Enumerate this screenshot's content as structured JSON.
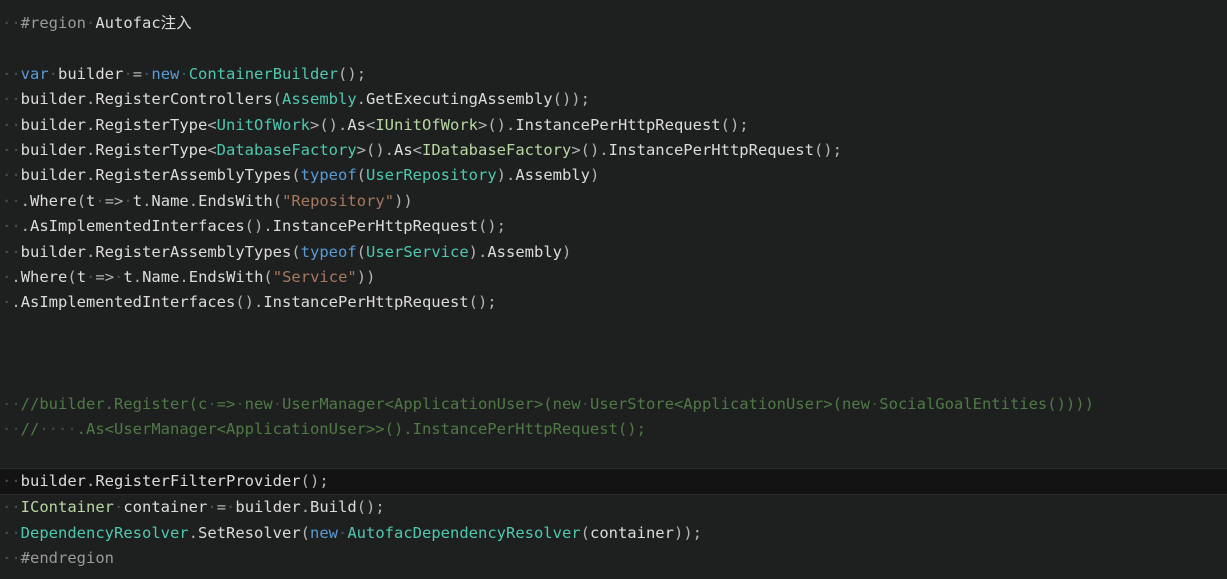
{
  "editor": {
    "theme": "dark",
    "background_color": "#1e1f1f",
    "current_line_background": "#131313",
    "language": "csharp",
    "whitespace_dot": "·",
    "colors": {
      "plain_text": "#dcdcdc",
      "keyword": "#5a9bd5",
      "type": "#4ec9b0",
      "interface": "#b8d7a3",
      "string": "#a8785f",
      "comment": "#4f7a46",
      "preprocessor": "#9a9a9a",
      "punctuation": "#b4b4b4",
      "whitespace_marker": "#3f5361"
    }
  },
  "code": {
    "lines": [
      {
        "id": "line-1",
        "current": false,
        "text": "  #region Autofac注入"
      },
      {
        "id": "line-2",
        "current": false,
        "text": ""
      },
      {
        "id": "line-3",
        "current": false,
        "text": "  var builder = new ContainerBuilder();"
      },
      {
        "id": "line-4",
        "current": false,
        "text": "  builder.RegisterControllers(Assembly.GetExecutingAssembly());"
      },
      {
        "id": "line-5",
        "current": false,
        "text": "  builder.RegisterType<UnitOfWork>().As<IUnitOfWork>().InstancePerHttpRequest();"
      },
      {
        "id": "line-6",
        "current": false,
        "text": "  builder.RegisterType<DatabaseFactory>().As<IDatabaseFactory>().InstancePerHttpRequest();"
      },
      {
        "id": "line-7",
        "current": false,
        "text": "  builder.RegisterAssemblyTypes(typeof(UserRepository).Assembly)"
      },
      {
        "id": "line-8",
        "current": false,
        "text": "  .Where(t => t.Name.EndsWith(\"Repository\"))"
      },
      {
        "id": "line-9",
        "current": false,
        "text": "  .AsImplementedInterfaces().InstancePerHttpRequest();"
      },
      {
        "id": "line-10",
        "current": false,
        "text": "  builder.RegisterAssemblyTypes(typeof(UserService).Assembly)"
      },
      {
        "id": "line-11",
        "current": false,
        "text": " .Where(t => t.Name.EndsWith(\"Service\"))"
      },
      {
        "id": "line-12",
        "current": false,
        "text": " .AsImplementedInterfaces().InstancePerHttpRequest();"
      },
      {
        "id": "line-13",
        "current": false,
        "text": ""
      },
      {
        "id": "line-14",
        "current": false,
        "text": ""
      },
      {
        "id": "line-15",
        "current": false,
        "text": ""
      },
      {
        "id": "line-16",
        "current": false,
        "text": "  //builder.Register(c => new UserManager<ApplicationUser>(new UserStore<ApplicationUser>(new SocialGoalEntities())))"
      },
      {
        "id": "line-17",
        "current": false,
        "text": "  //    .As<UserManager<ApplicationUser>>().InstancePerHttpRequest();"
      },
      {
        "id": "line-18",
        "current": false,
        "text": ""
      },
      {
        "id": "line-19",
        "current": true,
        "text": "  builder.RegisterFilterProvider();"
      },
      {
        "id": "line-20",
        "current": false,
        "text": "  IContainer container = builder.Build();"
      },
      {
        "id": "line-21",
        "current": false,
        "text": "  DependencyResolver.SetResolver(new AutofacDependencyResolver(container));"
      },
      {
        "id": "line-22",
        "current": false,
        "text": "  #endregion"
      }
    ],
    "identifiers": {
      "keywords": [
        "var",
        "new",
        "typeof"
      ],
      "types": [
        "ContainerBuilder",
        "Assembly",
        "UnitOfWork",
        "DatabaseFactory",
        "UserRepository",
        "UserService",
        "DependencyResolver",
        "AutofacDependencyResolver"
      ],
      "interfaces": [
        "IUnitOfWork",
        "IDatabaseFactory",
        "IContainer"
      ],
      "strings": [
        "\"Repository\"",
        "\"Service\""
      ],
      "preprocessor_directives": [
        "#region",
        "#endregion"
      ],
      "region_name": "Autofac注入"
    }
  }
}
